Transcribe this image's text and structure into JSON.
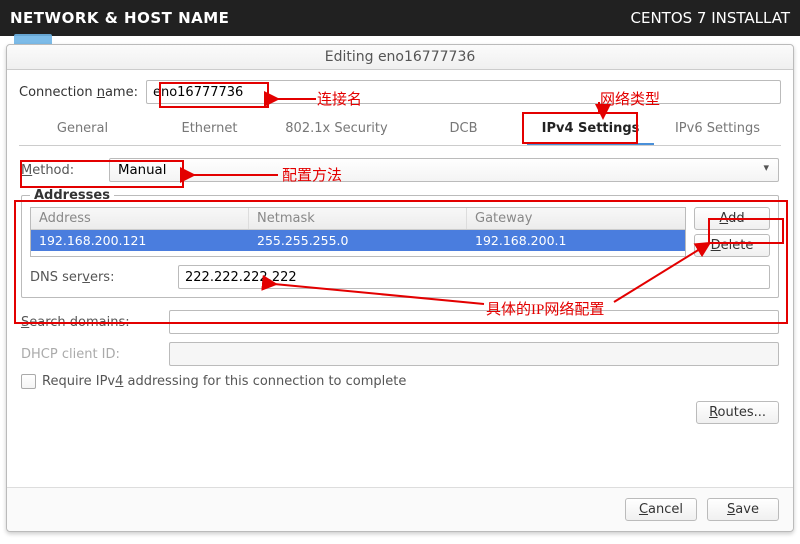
{
  "installer": {
    "left_title": "NETWORK & HOST NAME",
    "right_title": "CENTOS 7 INSTALLAT"
  },
  "dialog": {
    "title": "Editing eno16777736",
    "connection_label_pre": "Connection ",
    "connection_label_u": "n",
    "connection_label_post": "ame:",
    "connection_name": "eno16777736",
    "tabs": {
      "general": "General",
      "ethernet": "Ethernet",
      "security": "802.1x Security",
      "dcb": "DCB",
      "ipv4": "IPv4 Settings",
      "ipv6": "IPv6 Settings"
    },
    "method_label_u": "M",
    "method_label_post": "ethod:",
    "method_value": "Manual",
    "addresses": {
      "legend": "Addresses",
      "headers": {
        "address": "Address",
        "netmask": "Netmask",
        "gateway": "Gateway"
      },
      "rows": [
        {
          "address": "192.168.200.121",
          "netmask": "255.255.255.0",
          "gateway": "192.168.200.1"
        }
      ],
      "add_u": "A",
      "add_post": "dd",
      "delete_u": "D",
      "delete_post": "elete"
    },
    "dns_label_pre": "DNS ser",
    "dns_label_u": "v",
    "dns_label_post": "ers:",
    "dns_value": "222.222.222.222",
    "search_label_pre": "S",
    "search_label_post": "earch domains:",
    "search_value": "",
    "dhcp_label": "DHCP client ID:",
    "dhcp_value": "",
    "require_chk_pre": "Require IPv",
    "require_chk_u": "4",
    "require_chk_post": " addressing for this connection to complete",
    "routes_u": "R",
    "routes_post": "outes...",
    "cancel_u": "C",
    "cancel_post": "ancel",
    "save_u": "S",
    "save_post": "ave"
  },
  "annotations": {
    "conn_name": "连接名",
    "net_type": "网络类型",
    "method": "配置方法",
    "ip_config": "具体的IP网络配置"
  }
}
